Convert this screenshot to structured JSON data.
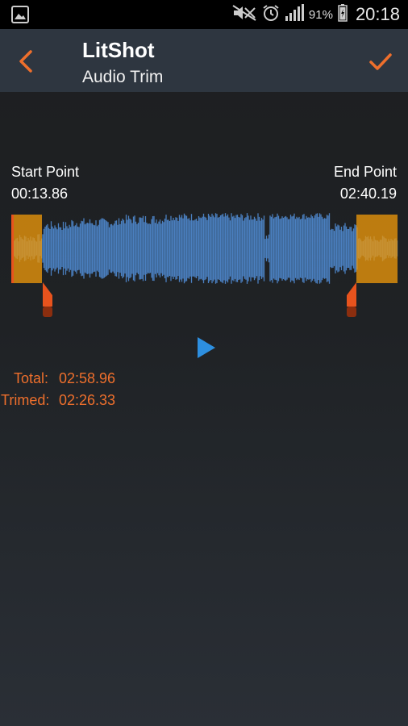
{
  "status_bar": {
    "battery_percent": "91%",
    "time": "20:18",
    "icons": [
      "gallery-icon",
      "mute-icon",
      "alarm-icon",
      "signal-icon",
      "battery-icon"
    ]
  },
  "app_bar": {
    "title": "LitShot",
    "subtitle": "Audio Trim",
    "back_icon": "chevron-left-icon",
    "confirm_icon": "checkmark-icon"
  },
  "trim": {
    "start_label": "Start Point",
    "start_time": "00:13.86",
    "end_label": "End Point",
    "end_time": "02:40.19",
    "total_label": "Total:",
    "total_value": "02:58.96",
    "trimmed_label": "Trimed:",
    "trimmed_value": "02:26.33"
  },
  "colors": {
    "accent": "#ee6f2c",
    "waveform": "#4a7fbf",
    "trim_overlay": "#eb960a",
    "app_bar": "#2e3640"
  }
}
